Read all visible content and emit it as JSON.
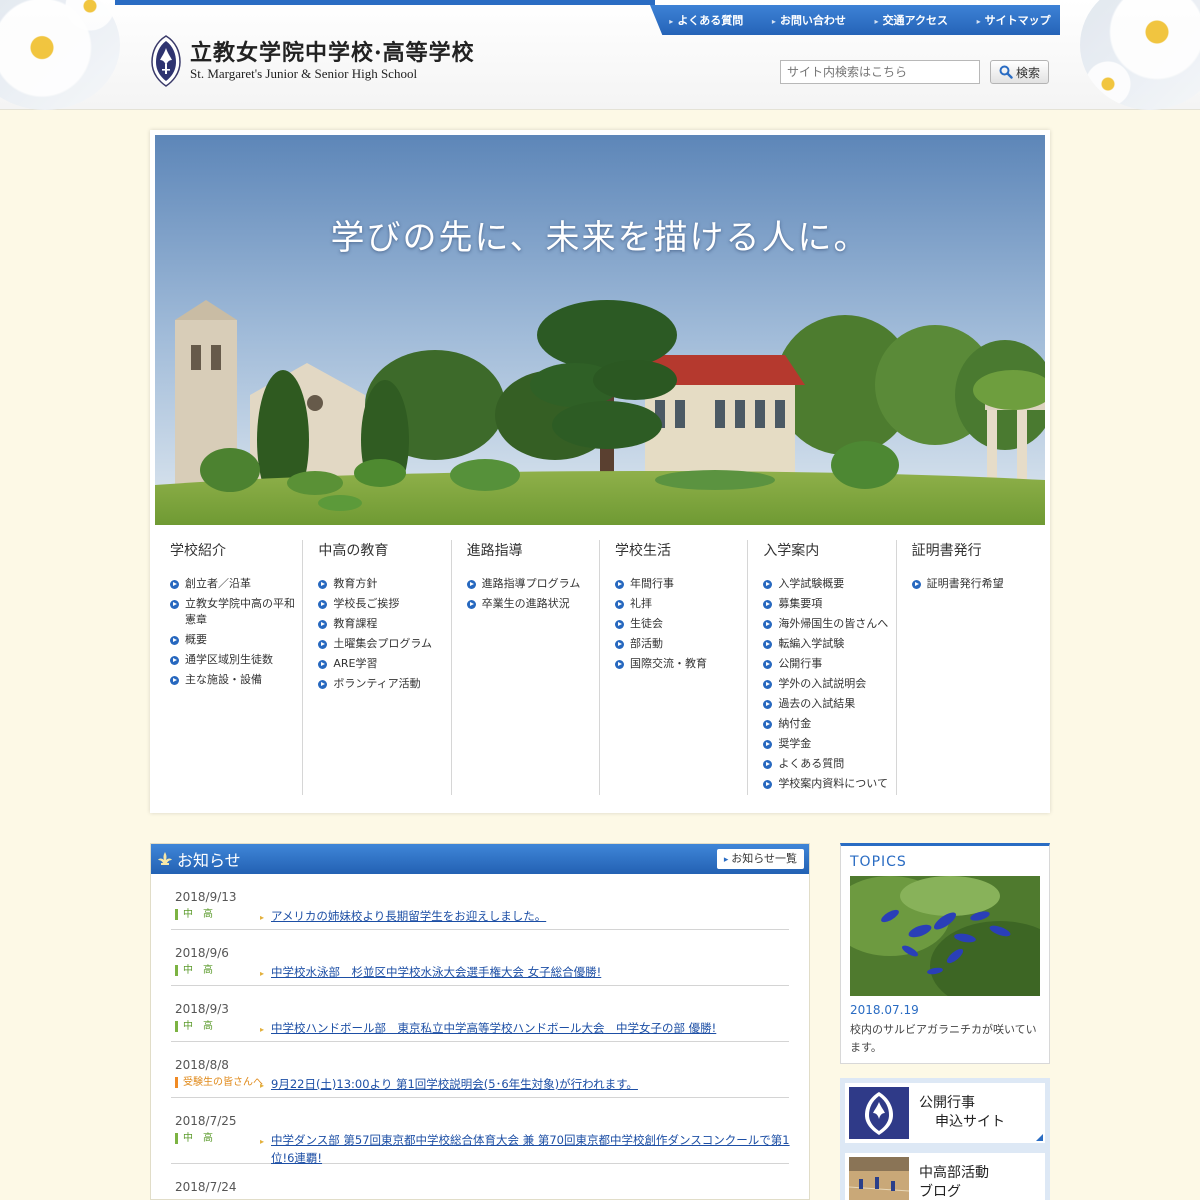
{
  "header": {
    "util_links": [
      "よくある質問",
      "お問い合わせ",
      "交通アクセス",
      "サイトマップ"
    ],
    "logo_jp": "立教女学院中学校·高等学校",
    "logo_en": "St. Margaret's Junior & Senior High School",
    "search_placeholder": "サイト内検索はこちら",
    "search_button": "検索"
  },
  "hero": {
    "tagline": "学びの先に、未来を描ける人に。"
  },
  "nav": [
    {
      "title": "学校紹介",
      "items": [
        "創立者／沿革",
        "立教女学院中高の平和憲章",
        "概要",
        "通学区域別生徒数",
        "主な施設・設備"
      ]
    },
    {
      "title": "中高の教育",
      "items": [
        "教育方針",
        "学校長ご挨拶",
        "教育課程",
        "土曜集会プログラム",
        "ARE学習",
        "ボランティア活動"
      ]
    },
    {
      "title": "進路指導",
      "items": [
        "進路指導プログラム",
        "卒業生の進路状況"
      ]
    },
    {
      "title": "学校生活",
      "items": [
        "年間行事",
        "礼拝",
        "生徒会",
        "部活動",
        "国際交流・教育"
      ]
    },
    {
      "title": "入学案内",
      "items": [
        "入学試験概要",
        "募集要項",
        "海外帰国生の皆さんへ",
        "転編入学試験",
        "公開行事",
        "学外の入試説明会",
        "過去の入試結果",
        "納付金",
        "奨学金",
        "よくある質問",
        "学校案内資料について"
      ]
    },
    {
      "title": "証明書発行",
      "items": [
        "証明書発行希望"
      ]
    }
  ],
  "news": {
    "title": "お知らせ",
    "more": "お知らせ一覧",
    "items": [
      {
        "date": "2018/9/13",
        "category": "中　高",
        "title": "アメリカの姉妹校より長期留学生をお迎えしました。",
        "accent": "green"
      },
      {
        "date": "2018/9/6",
        "category": "中　高",
        "title": "中学校水泳部　杉並区中学校水泳大会選手権大会 女子総合優勝!",
        "accent": "green"
      },
      {
        "date": "2018/9/3",
        "category": "中　高",
        "title": "中学校ハンドボール部　東京私立中学高等学校ハンドボール大会　中学女子の部 優勝!",
        "accent": "green"
      },
      {
        "date": "2018/8/8",
        "category": "受験生の皆さんへ",
        "title": "9月22日(土)13:00より 第1回学校説明会(5･6年生対象)が行われます。",
        "accent": "orange"
      },
      {
        "date": "2018/7/25",
        "category": "中　高",
        "title": "中学ダンス部 第57回東京都中学校総合体育大会 兼 第70回東京都中学校創作ダンスコンクールで第1位!6連覇!",
        "accent": "green"
      },
      {
        "date": "2018/7/24",
        "category": "",
        "title": "",
        "accent": "green"
      }
    ]
  },
  "topics": {
    "title": "TOPICS",
    "date": "2018.07.19",
    "caption": "校内のサルビアガラニチカが咲いています。"
  },
  "banners": {
    "event": "公開行事\n　　申込サイト",
    "event_line1": "公開行事",
    "event_line2": "申込サイト",
    "blog_line1": "中高部活動",
    "blog_line2": "ブログ"
  },
  "colors": {
    "brand_blue": "#2a6cc3",
    "background": "#fdf9e6",
    "link": "#1d4fa5"
  }
}
